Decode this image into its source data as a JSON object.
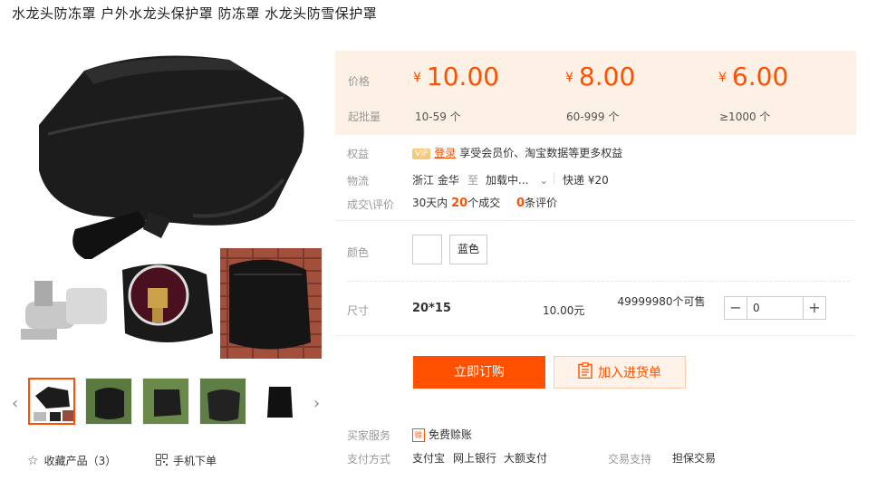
{
  "title": "水龙头防冻罩 户外水龙头保护罩 防冻罩 水龙头防雪保护罩",
  "gallery": {
    "favorite_label": "收藏产品（3）",
    "mobile_label": "手机下单",
    "thumbnail_count": 5
  },
  "price": {
    "price_label": "价格",
    "batch_label": "起批量",
    "currency": "¥",
    "tiers": [
      {
        "price": "10.00",
        "qty": "10-59 个"
      },
      {
        "price": "8.00",
        "qty": "60-999 个"
      },
      {
        "price": "6.00",
        "qty": "≥1000 个"
      }
    ]
  },
  "rights": {
    "label": "权益",
    "vip": "VIP",
    "login": "登录",
    "text": "享受会员价、淘宝数据等更多权益"
  },
  "logistics": {
    "label": "物流",
    "origin": "浙江 金华",
    "to": "至",
    "destination": "加载中...",
    "express": "快递 ¥20"
  },
  "deals": {
    "label": "成交\\评价",
    "prefix": "30天内",
    "count": "20",
    "count_suffix": "个成交",
    "reviews": "0",
    "reviews_suffix": "条评价"
  },
  "color": {
    "label": "颜色",
    "option": "蓝色"
  },
  "size": {
    "label": "尺寸",
    "value": "20*15",
    "price": "10.00元",
    "stock": "49999980个可售",
    "quantity": "0",
    "minus": "−",
    "plus": "+"
  },
  "actions": {
    "buy": "立即订购",
    "cart": "加入进货单"
  },
  "service": {
    "buyer_label": "买家服务",
    "buyer_value": "免费赊账",
    "pay_label": "支付方式",
    "pay_methods": [
      "支付宝",
      "网上银行",
      "大额支付"
    ],
    "trade_label": "交易支持",
    "trade_value": "担保交易"
  },
  "colors": {
    "accent": "#ff5000",
    "panel_bg": "#fdf0e5"
  }
}
